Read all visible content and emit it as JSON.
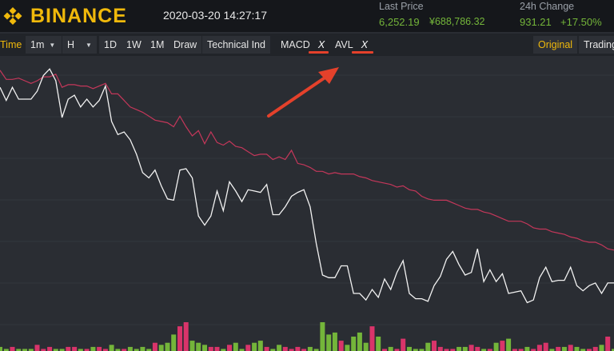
{
  "header": {
    "logo_text": "BINANCE",
    "datetime": "2020-03-20 14:27:17",
    "last_price_label": "Last Price",
    "last_price_usd": "6,252.19",
    "last_price_cny": "¥688,786.32",
    "change_label": "24h Change",
    "change_abs": "931.21",
    "change_pct": "+17.50%"
  },
  "toolbar": {
    "time_label": "Time",
    "interval_value": "1m",
    "chart_style_value": "H",
    "btn_1d": "1D",
    "btn_1w": "1W",
    "btn_1m": "1M",
    "btn_draw": "Draw",
    "btn_technical": "Technical Ind",
    "indicator_macd": "MACD",
    "indicator_avl": "AVL",
    "remove_glyph": "X",
    "original_label": "Original",
    "trading_label": "Trading"
  },
  "colors": {
    "brand": "#f0b90b",
    "positive": "#74b53a",
    "avg_line": "#c4375a",
    "annotation": "#e4412b"
  },
  "chart_data": {
    "type": "line",
    "series": [
      {
        "values": [
          366,
          356,
          366,
          357,
          357,
          357,
          363,
          375,
          380,
          371,
          343,
          357,
          360,
          351,
          357,
          351,
          356,
          367,
          340,
          330,
          332,
          326,
          315,
          301,
          297,
          303,
          291,
          281,
          280,
          303,
          304,
          297,
          268,
          261,
          268,
          287,
          272,
          294,
          287,
          279,
          288,
          287,
          286,
          292,
          269,
          269,
          275,
          283,
          286,
          288,
          275,
          247,
          223,
          221,
          221,
          230,
          230,
          209,
          209,
          204,
          212,
          206,
          220,
          212,
          225,
          234,
          209,
          205,
          205,
          203,
          215,
          222,
          235,
          241,
          231,
          223,
          225,
          243,
          218,
          227,
          218,
          224,
          209,
          210,
          211,
          202,
          204,
          221,
          229,
          218,
          219,
          219,
          229,
          215,
          211,
          215,
          217,
          209,
          217,
          217
        ]
      },
      {
        "values": [
          379,
          372,
          372,
          373,
          371,
          369,
          371,
          374,
          374,
          376,
          366,
          368,
          368,
          367,
          367,
          365,
          367,
          369,
          361,
          361,
          356,
          351,
          349,
          347,
          344,
          341,
          340,
          339,
          336,
          344,
          336,
          329,
          333,
          323,
          332,
          324,
          322,
          325,
          321,
          320,
          317,
          314,
          315,
          315,
          311,
          313,
          311,
          318,
          308,
          307,
          305,
          302,
          302,
          300,
          301,
          300,
          300,
          300,
          298,
          297,
          295,
          294,
          293,
          292,
          290,
          291,
          288,
          287,
          283,
          281,
          280,
          280,
          280,
          278,
          276,
          274,
          273,
          273,
          271,
          270,
          268,
          266,
          264,
          264,
          264,
          262,
          259,
          258,
          258,
          256,
          255,
          254,
          252,
          251,
          249,
          248,
          248,
          246,
          243,
          242
        ]
      },
      {
        "name": "Volume",
        "values": [
          2,
          1,
          2,
          1,
          1,
          1,
          3,
          1,
          2,
          1,
          1,
          2,
          2,
          1,
          1,
          2,
          2,
          1,
          3,
          1,
          1,
          2,
          1,
          2,
          1,
          4,
          3,
          4,
          8,
          12,
          14,
          5,
          4,
          3,
          2,
          2,
          1,
          3,
          4,
          1,
          3,
          4,
          5,
          2,
          1,
          3,
          2,
          1,
          2,
          1,
          2,
          1,
          14,
          8,
          9,
          5,
          3,
          7,
          9,
          4,
          12,
          7,
          1,
          2,
          1,
          6,
          2,
          1,
          1,
          4,
          5,
          2,
          1,
          1,
          2,
          2,
          3,
          2,
          1,
          1,
          4,
          5,
          6,
          1,
          1,
          2,
          1,
          3,
          4,
          1,
          2,
          2,
          3,
          2,
          1,
          1,
          2,
          3,
          7,
          1
        ]
      }
    ]
  }
}
